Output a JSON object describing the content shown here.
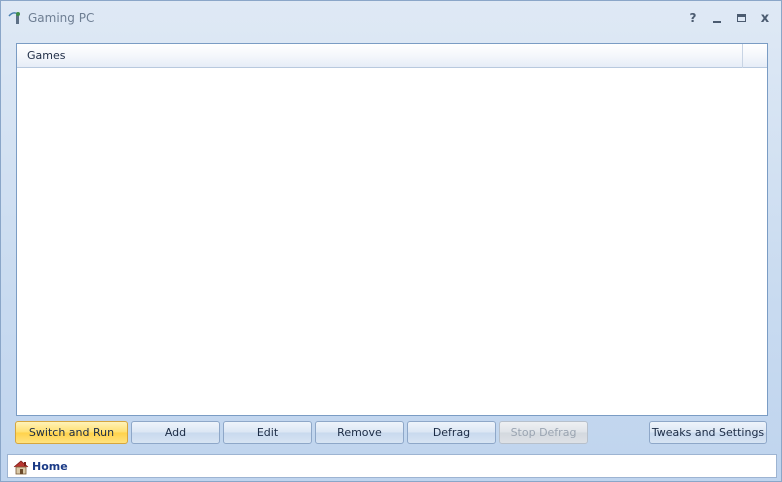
{
  "window": {
    "title": "Gaming PC",
    "controls": {
      "help": "?",
      "close": "x"
    }
  },
  "list": {
    "columns": [
      "Games"
    ],
    "rows": []
  },
  "buttons": {
    "switch_run": "Switch and Run",
    "add": "Add",
    "edit": "Edit",
    "remove": "Remove",
    "defrag": "Defrag",
    "stop_defrag": "Stop Defrag",
    "tweaks": "Tweaks and Settings"
  },
  "status": {
    "location": "Home"
  },
  "colors": {
    "primary_button": "#ffd24a",
    "frame": "#c9dbf0",
    "status_text": "#1a3a86"
  },
  "icons": {
    "app": "gaming-pc-icon",
    "home": "home-icon"
  }
}
